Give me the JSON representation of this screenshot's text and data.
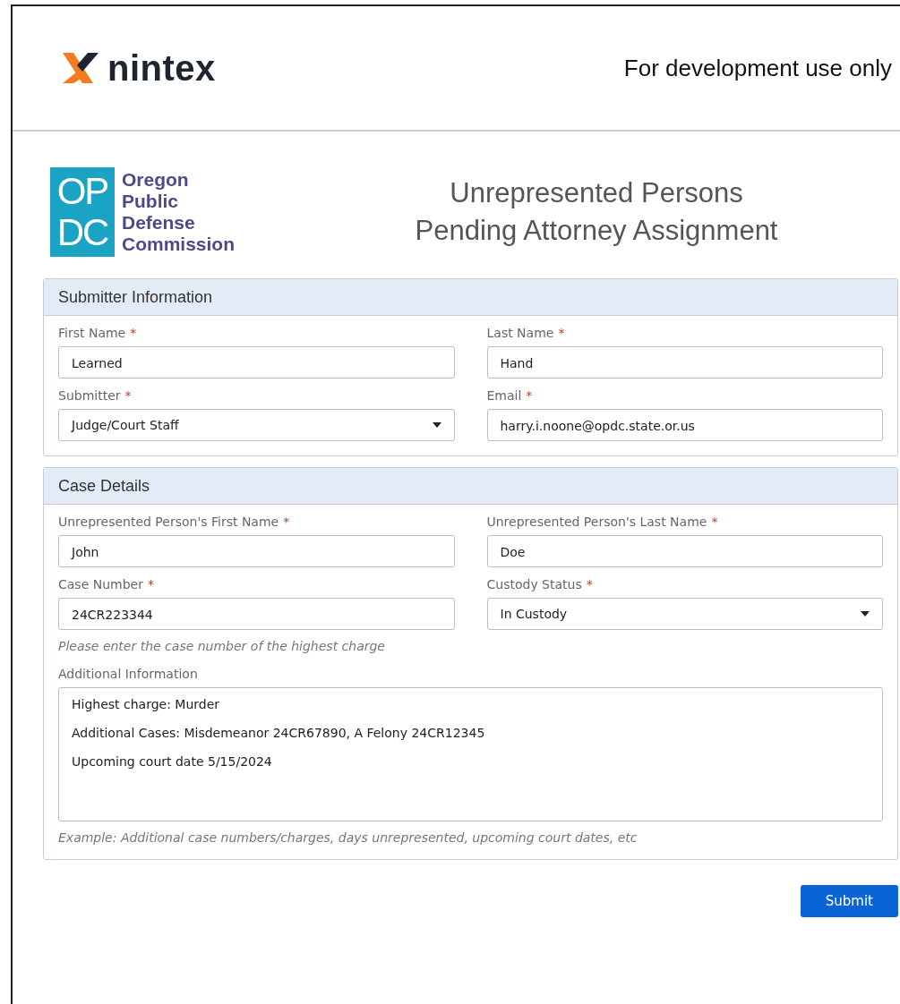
{
  "header": {
    "brand": "nintex",
    "notice": "For development use only"
  },
  "org_logo": {
    "letters": [
      "OP",
      "DC"
    ],
    "name_lines": [
      "Oregon",
      "Public",
      "Defense",
      "Commission"
    ]
  },
  "form_title": [
    "Unrepresented Persons",
    "Pending Attorney Assignment"
  ],
  "sections": [
    {
      "title": "Submitter Information",
      "fields": [
        {
          "kind": "text",
          "label": "First Name",
          "required_mark": "*",
          "value": "Learned"
        },
        {
          "kind": "text",
          "label": "Last Name",
          "required_mark": "*",
          "value": "Hand"
        },
        {
          "kind": "select",
          "label": "Submitter",
          "required_mark": "*",
          "value": "Judge/Court Staff"
        },
        {
          "kind": "text",
          "label": "Email",
          "required_mark": "*",
          "value": "harry.i.noone@opdc.state.or.us"
        }
      ]
    },
    {
      "title": "Case Details",
      "fields": [
        {
          "kind": "text",
          "label": "Unrepresented Person's First Name",
          "required_mark": "*",
          "value": "John"
        },
        {
          "kind": "text",
          "label": "Unrepresented Person's Last Name",
          "required_mark": "*",
          "value": "Doe"
        },
        {
          "kind": "text",
          "label": "Case Number",
          "required_mark": "*",
          "value": "24CR223344",
          "hint": "Please enter the case number of the highest charge"
        },
        {
          "kind": "select",
          "label": "Custody Status",
          "required_mark": "*",
          "value": "In Custody"
        },
        {
          "kind": "textarea",
          "label": "Additional Information",
          "lines": [
            "Highest charge: Murder",
            "Additional Cases: Misdemeanor 24CR67890, A Felony 24CR12345",
            "Upcoming court date 5/15/2024"
          ],
          "hint": "Example: Additional case numbers/charges, days unrepresented, upcoming court dates, etc"
        }
      ]
    }
  ],
  "submit_button": "Submit"
}
